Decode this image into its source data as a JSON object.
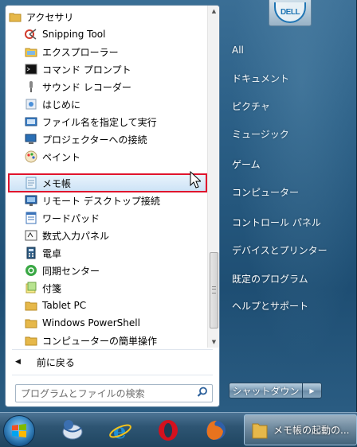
{
  "programs": [
    {
      "label": "アクセサリ",
      "icon": "folder-icon"
    },
    {
      "label": "Snipping Tool",
      "icon": "snipping-tool-icon"
    },
    {
      "label": "エクスプローラー",
      "icon": "explorer-icon"
    },
    {
      "label": "コマンド プロンプト",
      "icon": "command-prompt-icon"
    },
    {
      "label": "サウンド レコーダー",
      "icon": "microphone-icon"
    },
    {
      "label": "はじめに",
      "icon": "getting-started-icon"
    },
    {
      "label": "ファイル名を指定して実行",
      "icon": "run-icon"
    },
    {
      "label": "プロジェクターへの接続",
      "icon": "projector-icon"
    },
    {
      "label": "ペイント",
      "icon": "paint-icon"
    },
    {
      "label": "メモ帳",
      "icon": "notepad-icon"
    },
    {
      "label": "リモート デスクトップ接続",
      "icon": "remote-desktop-icon"
    },
    {
      "label": "ワードパッド",
      "icon": "wordpad-icon"
    },
    {
      "label": "数式入力パネル",
      "icon": "math-input-icon"
    },
    {
      "label": "電卓",
      "icon": "calculator-icon"
    },
    {
      "label": "同期センター",
      "icon": "sync-center-icon"
    },
    {
      "label": "付箋",
      "icon": "sticky-notes-icon"
    },
    {
      "label": "Tablet PC",
      "icon": "folder-icon"
    },
    {
      "label": "Windows PowerShell",
      "icon": "folder-icon"
    },
    {
      "label": "コンピューターの簡単操作",
      "icon": "folder-icon"
    }
  ],
  "selected_program": "メモ帳",
  "back_label": "前に戻る",
  "search": {
    "placeholder": "プログラムとファイルの検索"
  },
  "right_items": [
    {
      "label": "All"
    },
    {
      "label": "ドキュメント"
    },
    {
      "label": "ピクチャ"
    },
    {
      "label": "ミュージック"
    },
    {
      "label": "ゲーム"
    },
    {
      "label": "コンピューター"
    },
    {
      "label": "コントロール パネル"
    },
    {
      "label": "デバイスとプリンター"
    },
    {
      "label": "既定のプログラム"
    },
    {
      "label": "ヘルプとサポート"
    }
  ],
  "user_logo": "DELL",
  "shutdown_label": "シャットダウン",
  "taskbar": {
    "active_task_label": "メモ帳の起動の...",
    "pinned": [
      "thunderbird-icon",
      "internet-explorer-icon",
      "opera-icon",
      "firefox-icon"
    ]
  },
  "colors": {
    "selection_outline": "#e0142d",
    "menu_glass": "#2b5f86",
    "taskbar": "#2e5573"
  }
}
